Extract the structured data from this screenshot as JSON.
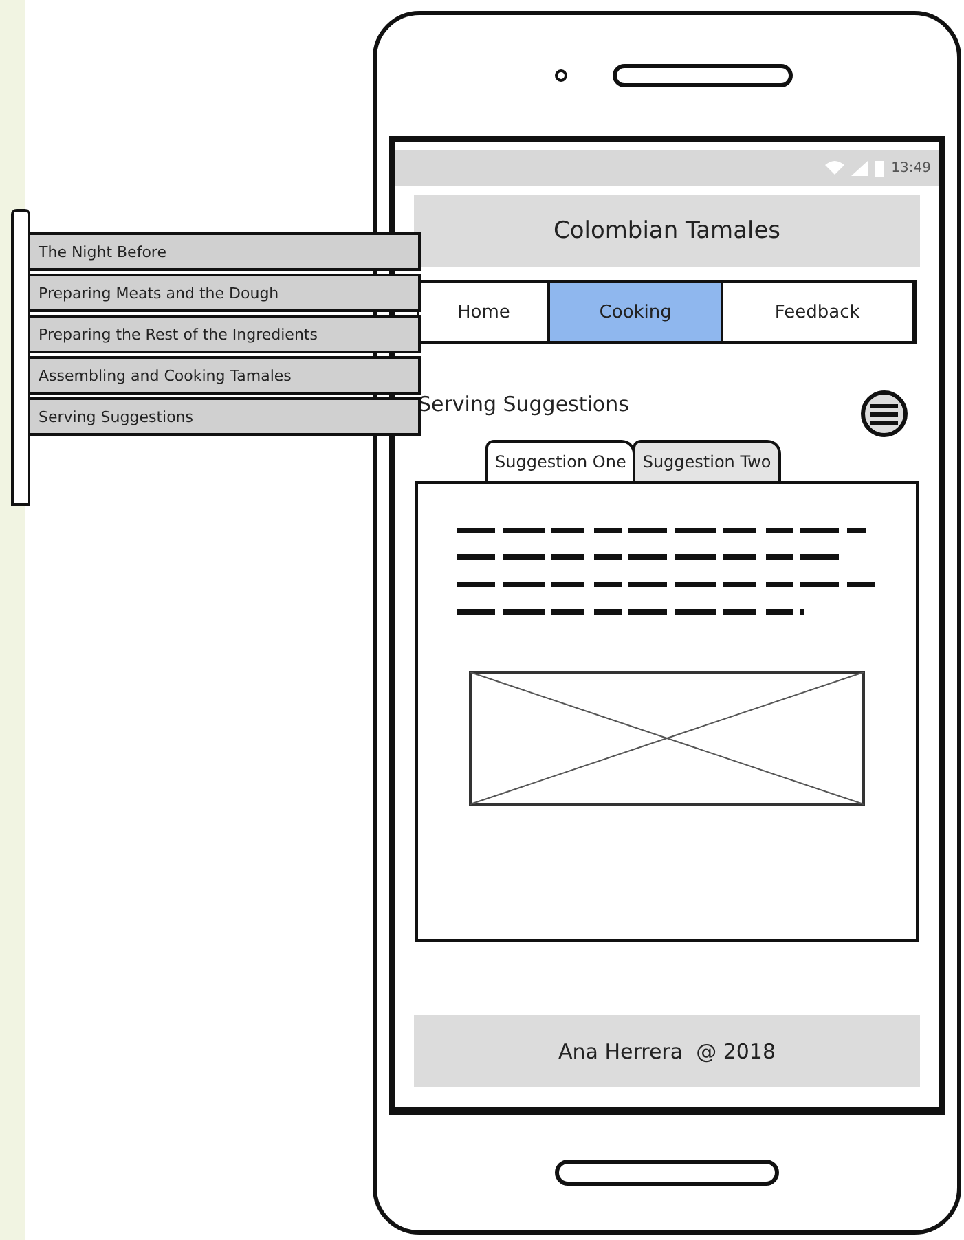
{
  "status_bar": {
    "time": "13:49"
  },
  "header": {
    "title": "Colombian Tamales"
  },
  "nav_tabs": [
    {
      "label": "Home",
      "selected": false
    },
    {
      "label": "Cooking",
      "selected": true
    },
    {
      "label": "Feedback",
      "selected": false
    }
  ],
  "section": {
    "title": "Serving Suggestions"
  },
  "suggestion_tabs": [
    {
      "label": "Suggestion One",
      "selected": true
    },
    {
      "label": "Suggestion Two",
      "selected": false
    }
  ],
  "side_menu": {
    "items": [
      {
        "label": "The Night Before"
      },
      {
        "label": "Preparing Meats and the Dough"
      },
      {
        "label": "Preparing the Rest of the Ingredients"
      },
      {
        "label": "Assembling and Cooking Tamales"
      },
      {
        "label": "Serving Suggestions"
      }
    ]
  },
  "footer": {
    "text": "Ana Herrera  @ 2018"
  }
}
